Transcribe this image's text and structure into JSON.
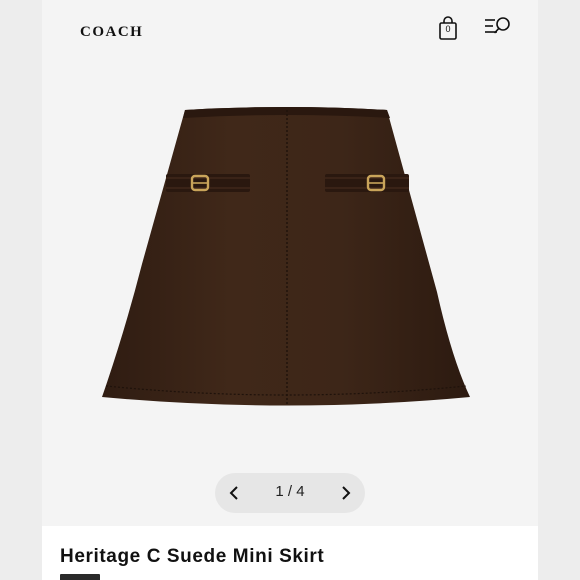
{
  "header": {
    "brand": "COACH",
    "bag_count": "0",
    "bag_icon": "shopping-bag-icon",
    "menu_icon": "menu-search-icon"
  },
  "gallery": {
    "pager_text": "1 / 4",
    "prev_icon": "chevron-left-icon",
    "next_icon": "chevron-right-icon"
  },
  "product": {
    "title": "Heritage C Suede Mini Skirt"
  },
  "colors": {
    "background": "#ededed",
    "screen": "#f4f4f4",
    "skirt": "#3a2417",
    "hardware": "#c9a45a"
  }
}
